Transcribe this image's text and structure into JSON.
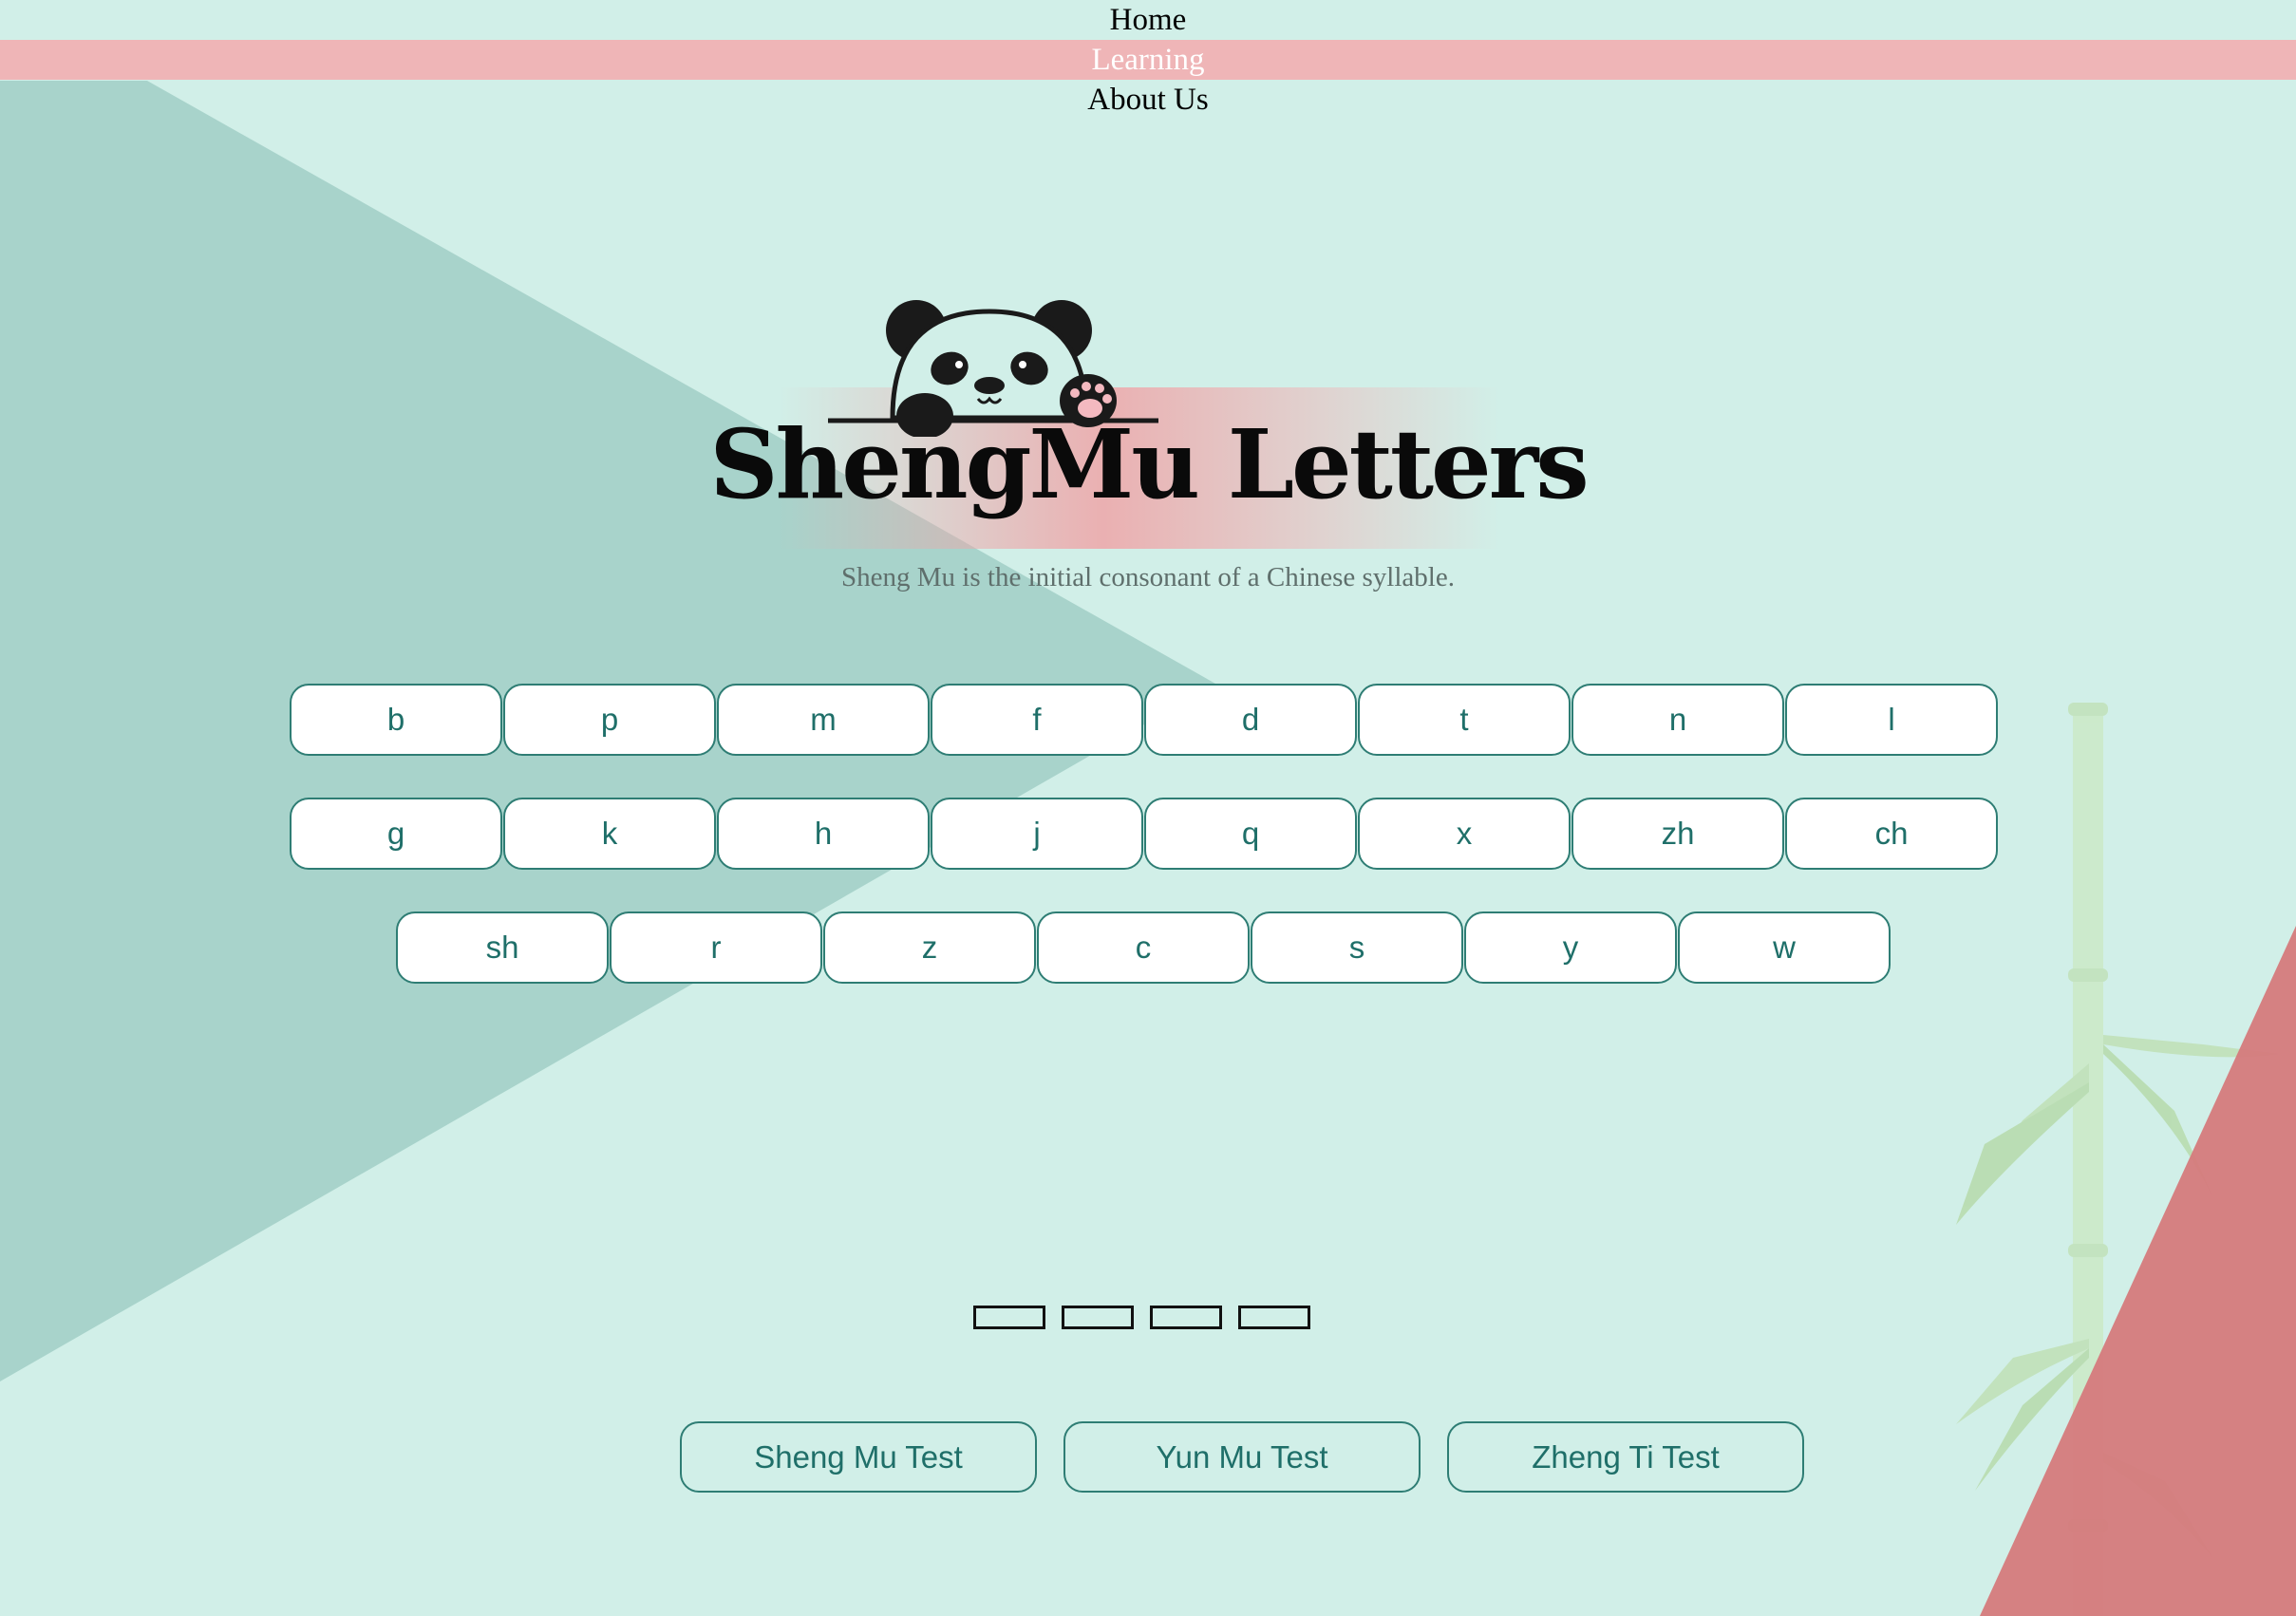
{
  "nav": {
    "items": [
      {
        "label": "Home",
        "active": false
      },
      {
        "label": "Learning",
        "active": true
      },
      {
        "label": "About Us",
        "active": false
      }
    ]
  },
  "hero": {
    "title": "ShengMu Letters",
    "subtitle": "Sheng Mu is the initial consonant of a Chinese syllable."
  },
  "letters": {
    "row1": [
      "b",
      "p",
      "m",
      "f",
      "d",
      "t",
      "n",
      "l"
    ],
    "row2": [
      "g",
      "k",
      "h",
      "j",
      "q",
      "x",
      "zh",
      "ch"
    ],
    "row3": [
      "sh",
      "r",
      "z",
      "c",
      "s",
      "y",
      "w"
    ]
  },
  "tests": [
    "Sheng Mu Test",
    "Yun Mu Test",
    "Zheng Ti Test"
  ],
  "colors": {
    "background": "#d1efe8",
    "dark_teal_triangle": "#a8d3cb",
    "nav_active": "#efb5b7",
    "accent_teal": "#1f6f69",
    "red_triangle": "#d57a7c"
  }
}
